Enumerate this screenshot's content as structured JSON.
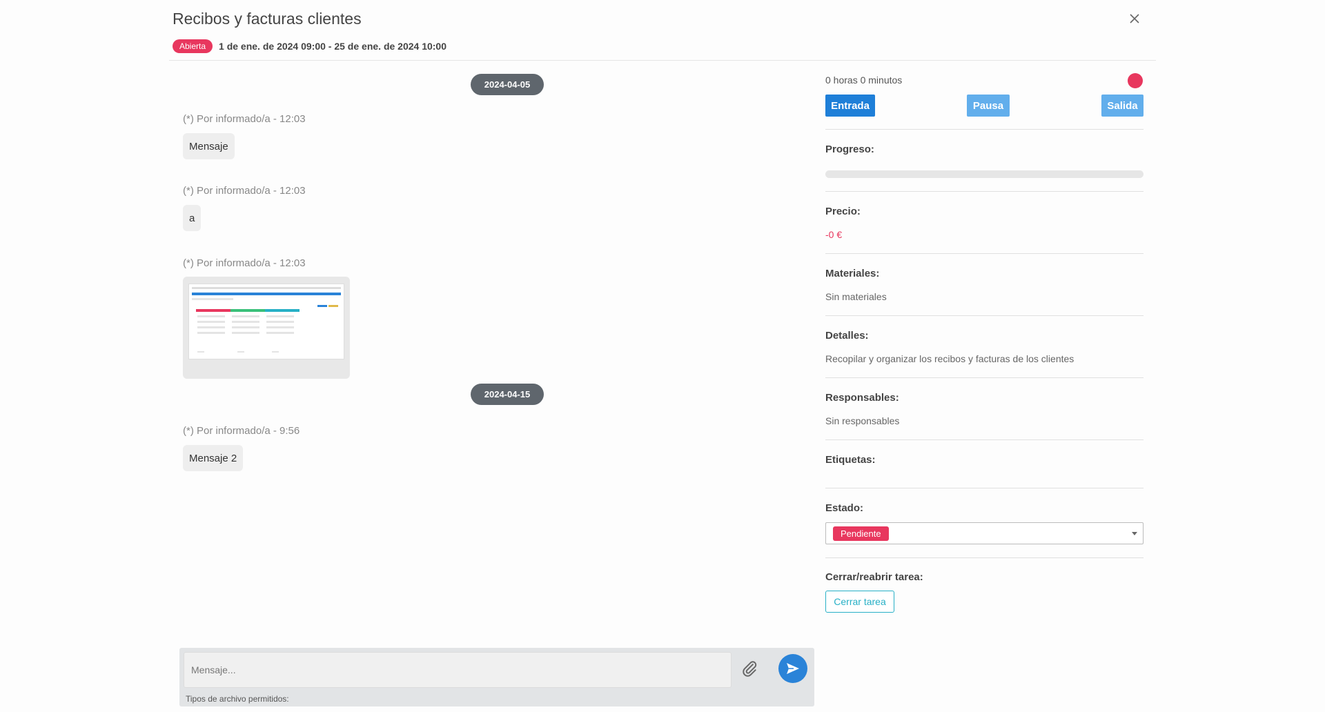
{
  "header": {
    "title": "Recibos y facturas clientes",
    "status_badge": "Abierta",
    "date_range": "1 de ene. de 2024 09:00 - 25 de ene. de 2024 10:00"
  },
  "chat": {
    "date_groups": [
      "2024-04-05",
      "2024-04-15"
    ],
    "messages": [
      {
        "meta": "(*) Por informado/a - 12:03",
        "text": "Mensaje"
      },
      {
        "meta": "(*) Por informado/a - 12:03",
        "text": "a"
      },
      {
        "meta": "(*) Por informado/a - 12:03",
        "text": ""
      },
      {
        "meta": "(*) Por informado/a - 9:56",
        "text": "Mensaje 2"
      }
    ]
  },
  "composer": {
    "placeholder": "Mensaje...",
    "file_types_label": "Tipos de archivo permitidos:"
  },
  "side": {
    "timer": "0 horas 0 minutos",
    "buttons": {
      "entry": "Entrada",
      "pause": "Pausa",
      "exit": "Salida"
    },
    "progress_label": "Progreso:",
    "progress_value": 0,
    "price_label": "Precio:",
    "price_value": "-0 €",
    "materials_label": "Materiales:",
    "materials_value": "Sin materiales",
    "details_label": "Detalles:",
    "details_value": "Recopilar y organizar los recibos y facturas de los clientes",
    "responsibles_label": "Responsables:",
    "responsibles_value": "Sin responsables",
    "tags_label": "Etiquetas:",
    "state_label": "Estado:",
    "state_value": "Pendiente",
    "close_reopen_label": "Cerrar/reabrir tarea:",
    "close_task_button": "Cerrar tarea"
  },
  "colors": {
    "accent_red": "#e8375e",
    "primary_blue": "#1e7fd8",
    "light_blue": "#62aeec",
    "teal": "#27b0c6"
  },
  "icons": [
    "close-icon",
    "paperclip-icon",
    "send-icon",
    "record-dot-icon",
    "chevron-down-icon"
  ]
}
